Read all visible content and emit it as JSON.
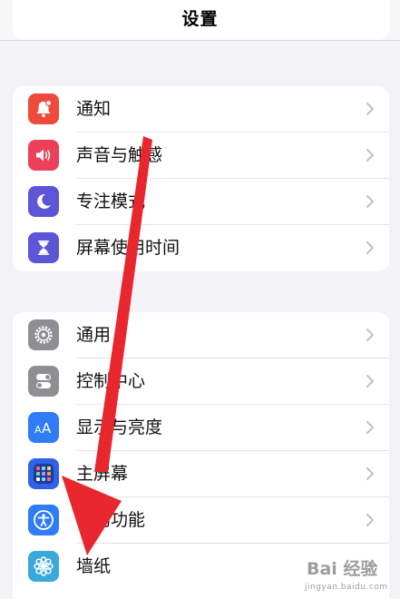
{
  "navbar": {
    "title": "设置"
  },
  "groups": [
    {
      "items": [
        {
          "label": "通知",
          "icon": "bell-badge-icon",
          "color": "#ee4b3c"
        },
        {
          "label": "声音与触感",
          "icon": "speaker-icon",
          "color": "#ec3f5a"
        },
        {
          "label": "专注模式",
          "icon": "moon-icon",
          "color": "#5c56d6"
        },
        {
          "label": "屏幕使用时间",
          "icon": "hourglass-icon",
          "color": "#5c56d6"
        }
      ]
    },
    {
      "items": [
        {
          "label": "通用",
          "icon": "gear-icon",
          "color": "#8e8e93"
        },
        {
          "label": "控制中心",
          "icon": "toggles-icon",
          "color": "#8e8e93"
        },
        {
          "label": "显示与亮度",
          "icon": "text-size-icon",
          "color": "#2f7cf6"
        },
        {
          "label": "主屏幕",
          "icon": "app-grid-icon",
          "color": "#2f62e6"
        },
        {
          "label": "辅助功能",
          "icon": "accessibility-icon",
          "color": "#2f7cf6"
        },
        {
          "label": "墙纸",
          "icon": "flower-icon",
          "color": "#3aa7dd"
        }
      ]
    }
  ],
  "overlay": {
    "arrow_color": "#e8262e"
  },
  "watermark": {
    "brand": "Bai 经验",
    "url": "jingyan.baidu.com"
  }
}
